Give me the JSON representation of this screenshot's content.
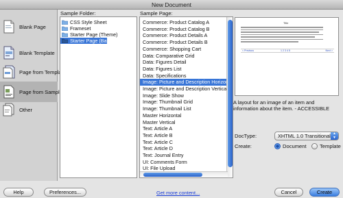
{
  "window": {
    "title": "New Document"
  },
  "sidebar": {
    "items": [
      {
        "label": "Blank Page",
        "icon": "blank-page-icon",
        "selected": false
      },
      {
        "label": "Blank Template",
        "icon": "blank-template-icon",
        "selected": false
      },
      {
        "label": "Page from Template",
        "icon": "page-from-template-icon",
        "selected": false
      },
      {
        "label": "Page from Sample",
        "icon": "page-from-sample-icon",
        "selected": true
      },
      {
        "label": "Other",
        "icon": "other-icon",
        "selected": false
      }
    ]
  },
  "sample_folder": {
    "label": "Sample Folder:",
    "items": [
      {
        "label": "CSS Style Sheet",
        "selected": false
      },
      {
        "label": "Frameset",
        "selected": false
      },
      {
        "label": "Starter Page (Theme)",
        "selected": false
      },
      {
        "label": "Starter Page (Basic)",
        "selected": true
      }
    ]
  },
  "sample_page": {
    "label": "Sample Page:",
    "items": [
      {
        "label": "Commerce: Product Catalog A",
        "selected": false
      },
      {
        "label": "Commerce: Product Catalog B",
        "selected": false
      },
      {
        "label": "Commerce: Product Details A",
        "selected": false
      },
      {
        "label": "Commerce: Product Details B",
        "selected": false
      },
      {
        "label": "Commerce: Shopping Cart",
        "selected": false
      },
      {
        "label": "Data: Comparative Grid",
        "selected": false
      },
      {
        "label": "Data: Figures Detail",
        "selected": false
      },
      {
        "label": "Data: Figures List",
        "selected": false
      },
      {
        "label": "Data: Specifications",
        "selected": false
      },
      {
        "label": "Image: Picture and Description Horizont",
        "selected": true
      },
      {
        "label": "Image: Picture and Description Vertical",
        "selected": false
      },
      {
        "label": "Image: Slide Show",
        "selected": false
      },
      {
        "label": "Image: Thumbnail Grid",
        "selected": false
      },
      {
        "label": "Image: Thumbnail List",
        "selected": false
      },
      {
        "label": "Master Horizontal",
        "selected": false
      },
      {
        "label": "Master Vertical",
        "selected": false
      },
      {
        "label": "Text: Article A",
        "selected": false
      },
      {
        "label": "Text: Article B",
        "selected": false
      },
      {
        "label": "Text: Article C",
        "selected": false
      },
      {
        "label": "Text: Article D",
        "selected": false
      },
      {
        "label": "Text: Journal Entry",
        "selected": false
      },
      {
        "label": "UI: Comments Form",
        "selected": false
      },
      {
        "label": "UI: File Upload",
        "selected": false
      }
    ]
  },
  "preview": {
    "thumb_title": "Title",
    "thumb_nav": [
      "< Previous",
      "1 2 3 4 5",
      "Next >"
    ],
    "description": "A layout for an image of an item and information about the item. - ACCESSIBLE"
  },
  "doctype": {
    "label": "DocType:",
    "value": "XHTML 1.0 Transitional"
  },
  "create": {
    "label": "Create:",
    "options": [
      {
        "label": "Document",
        "selected": true
      },
      {
        "label": "Template",
        "selected": false
      }
    ]
  },
  "link": {
    "label": "Get more content..."
  },
  "buttons": {
    "help": "Help",
    "preferences": "Preferences...",
    "cancel": "Cancel",
    "create": "Create"
  },
  "colors": {
    "selection": "#3875d7",
    "link": "#1a3dd8",
    "default_button": "#3a7de0"
  }
}
